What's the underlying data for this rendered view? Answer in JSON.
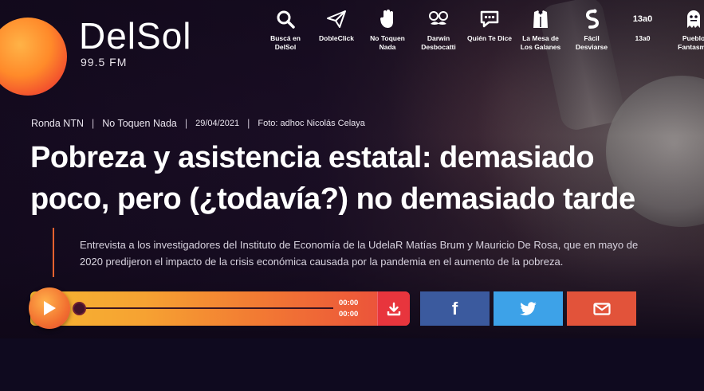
{
  "brand": {
    "name": "DelSol",
    "frequency": "99.5 FM"
  },
  "nav": [
    {
      "icon": "search-icon",
      "label": "Buscá en DelSol"
    },
    {
      "icon": "paper-plane-icon",
      "label": "DobleClick"
    },
    {
      "icon": "hand-icon",
      "label": "No Toquen Nada"
    },
    {
      "icon": "mustache-glasses-icon",
      "label": "Darwin Desbocatti"
    },
    {
      "icon": "chat-bubble-icon",
      "label": "Quién Te Dice"
    },
    {
      "icon": "tuxedo-icon",
      "label": "La Mesa de Los Galanes"
    },
    {
      "icon": "snake-icon",
      "label": "Fácil Desviarse"
    },
    {
      "icon": "13a0-logo-icon",
      "icon_text": "13a0",
      "label": "13a0"
    },
    {
      "icon": "ghost-icon",
      "label": "Pueblo Fantasma"
    }
  ],
  "article": {
    "section": "Ronda NTN",
    "program": "No Toquen Nada",
    "date": "29/04/2021",
    "photo_credit": "Foto: adhoc Nicolás Celaya",
    "title_line1": "Pobreza y asistencia estatal: demasiado",
    "title_line2": "poco, pero (¿todavía?) no demasiado tarde",
    "lede_line1": "Entrevista a los investigadores del Instituto de Economía de la UdelaR Matías Brum y Mauricio De Rosa, que en mayo de",
    "lede_line2": "2020 predijeron el impacto de la crisis económica causada por la pandemia en el aumento de la pobreza."
  },
  "player": {
    "current_time": "00:00",
    "duration": "00:00",
    "progress": 0
  },
  "share": [
    {
      "network": "facebook",
      "icon": "facebook-icon",
      "glyph": "f",
      "color": "#3b5a9e"
    },
    {
      "network": "twitter",
      "icon": "twitter-icon",
      "color": "#3da2e8"
    },
    {
      "network": "email",
      "icon": "mail-icon",
      "color": "#e2533a"
    }
  ],
  "colors": {
    "accent": "#e8622f",
    "player_start": "#f7b531",
    "player_end": "#ea4a3c"
  }
}
